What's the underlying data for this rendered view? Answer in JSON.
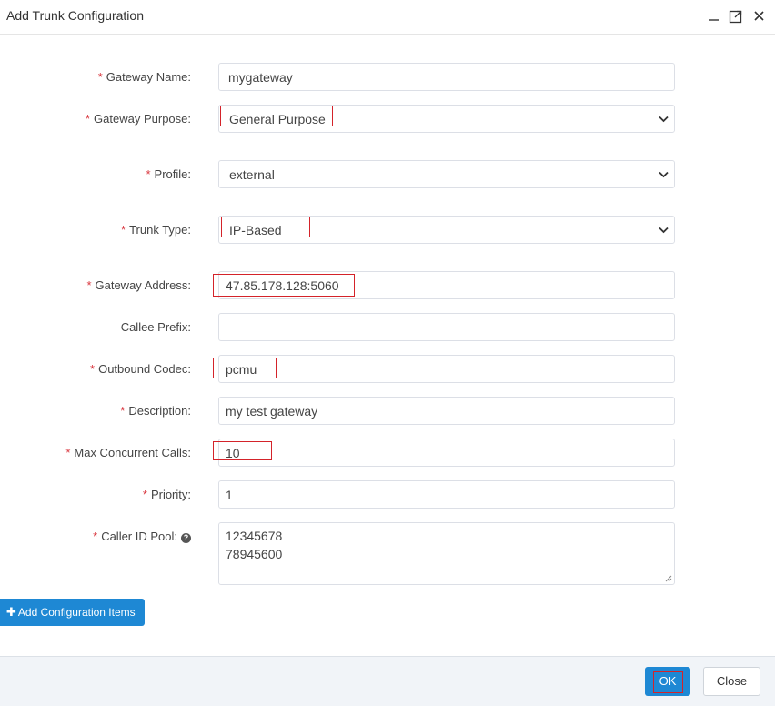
{
  "dialog": {
    "title": "Add Trunk Configuration"
  },
  "form": {
    "required_mark": "*",
    "gateway_name": {
      "label": "Gateway Name:",
      "value": "mygateway"
    },
    "gateway_purpose": {
      "label": "Gateway Purpose:",
      "value": "General Purpose"
    },
    "profile": {
      "label": "Profile:",
      "value": "external"
    },
    "trunk_type": {
      "label": "Trunk Type:",
      "value": "IP-Based"
    },
    "gateway_address": {
      "label": "Gateway Address:",
      "value": "47.85.178.128:5060"
    },
    "callee_prefix": {
      "label": "Callee Prefix:",
      "value": ""
    },
    "outbound_codec": {
      "label": "Outbound Codec:",
      "value": "pcmu"
    },
    "description": {
      "label": "Description:",
      "value": "my test gateway"
    },
    "max_concurrent_calls": {
      "label": "Max Concurrent Calls:",
      "value": "10"
    },
    "priority": {
      "label": "Priority:",
      "value": "1"
    },
    "caller_id_pool": {
      "label": "Caller ID Pool:",
      "lines": [
        "12345678",
        "78945600"
      ]
    }
  },
  "actions": {
    "add_config": "Add Configuration Items",
    "ok": "OK",
    "close": "Close"
  },
  "colors": {
    "primary": "#1e88d4",
    "required": "#d9363e",
    "highlight": "#d4232a"
  }
}
